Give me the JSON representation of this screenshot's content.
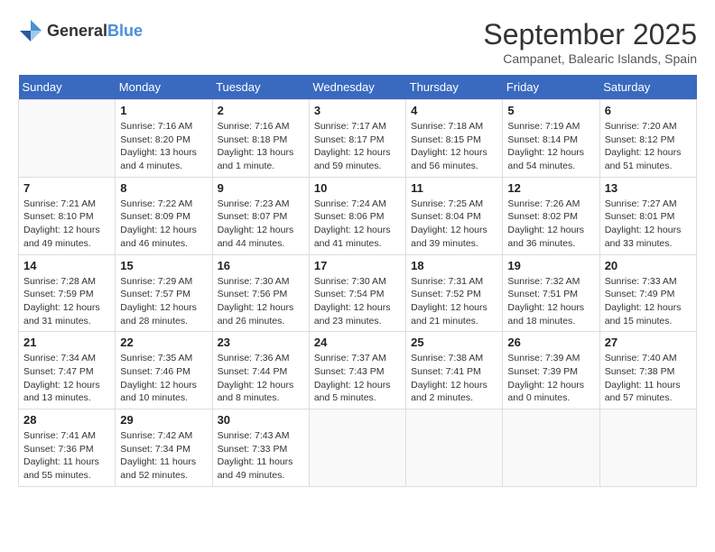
{
  "logo": {
    "general": "General",
    "blue": "Blue"
  },
  "title": "September 2025",
  "location": "Campanet, Balearic Islands, Spain",
  "weekdays": [
    "Sunday",
    "Monday",
    "Tuesday",
    "Wednesday",
    "Thursday",
    "Friday",
    "Saturday"
  ],
  "weeks": [
    [
      {
        "day": "",
        "info": ""
      },
      {
        "day": "1",
        "info": "Sunrise: 7:16 AM\nSunset: 8:20 PM\nDaylight: 13 hours\nand 4 minutes."
      },
      {
        "day": "2",
        "info": "Sunrise: 7:16 AM\nSunset: 8:18 PM\nDaylight: 13 hours\nand 1 minute."
      },
      {
        "day": "3",
        "info": "Sunrise: 7:17 AM\nSunset: 8:17 PM\nDaylight: 12 hours\nand 59 minutes."
      },
      {
        "day": "4",
        "info": "Sunrise: 7:18 AM\nSunset: 8:15 PM\nDaylight: 12 hours\nand 56 minutes."
      },
      {
        "day": "5",
        "info": "Sunrise: 7:19 AM\nSunset: 8:14 PM\nDaylight: 12 hours\nand 54 minutes."
      },
      {
        "day": "6",
        "info": "Sunrise: 7:20 AM\nSunset: 8:12 PM\nDaylight: 12 hours\nand 51 minutes."
      }
    ],
    [
      {
        "day": "7",
        "info": "Sunrise: 7:21 AM\nSunset: 8:10 PM\nDaylight: 12 hours\nand 49 minutes."
      },
      {
        "day": "8",
        "info": "Sunrise: 7:22 AM\nSunset: 8:09 PM\nDaylight: 12 hours\nand 46 minutes."
      },
      {
        "day": "9",
        "info": "Sunrise: 7:23 AM\nSunset: 8:07 PM\nDaylight: 12 hours\nand 44 minutes."
      },
      {
        "day": "10",
        "info": "Sunrise: 7:24 AM\nSunset: 8:06 PM\nDaylight: 12 hours\nand 41 minutes."
      },
      {
        "day": "11",
        "info": "Sunrise: 7:25 AM\nSunset: 8:04 PM\nDaylight: 12 hours\nand 39 minutes."
      },
      {
        "day": "12",
        "info": "Sunrise: 7:26 AM\nSunset: 8:02 PM\nDaylight: 12 hours\nand 36 minutes."
      },
      {
        "day": "13",
        "info": "Sunrise: 7:27 AM\nSunset: 8:01 PM\nDaylight: 12 hours\nand 33 minutes."
      }
    ],
    [
      {
        "day": "14",
        "info": "Sunrise: 7:28 AM\nSunset: 7:59 PM\nDaylight: 12 hours\nand 31 minutes."
      },
      {
        "day": "15",
        "info": "Sunrise: 7:29 AM\nSunset: 7:57 PM\nDaylight: 12 hours\nand 28 minutes."
      },
      {
        "day": "16",
        "info": "Sunrise: 7:30 AM\nSunset: 7:56 PM\nDaylight: 12 hours\nand 26 minutes."
      },
      {
        "day": "17",
        "info": "Sunrise: 7:30 AM\nSunset: 7:54 PM\nDaylight: 12 hours\nand 23 minutes."
      },
      {
        "day": "18",
        "info": "Sunrise: 7:31 AM\nSunset: 7:52 PM\nDaylight: 12 hours\nand 21 minutes."
      },
      {
        "day": "19",
        "info": "Sunrise: 7:32 AM\nSunset: 7:51 PM\nDaylight: 12 hours\nand 18 minutes."
      },
      {
        "day": "20",
        "info": "Sunrise: 7:33 AM\nSunset: 7:49 PM\nDaylight: 12 hours\nand 15 minutes."
      }
    ],
    [
      {
        "day": "21",
        "info": "Sunrise: 7:34 AM\nSunset: 7:47 PM\nDaylight: 12 hours\nand 13 minutes."
      },
      {
        "day": "22",
        "info": "Sunrise: 7:35 AM\nSunset: 7:46 PM\nDaylight: 12 hours\nand 10 minutes."
      },
      {
        "day": "23",
        "info": "Sunrise: 7:36 AM\nSunset: 7:44 PM\nDaylight: 12 hours\nand 8 minutes."
      },
      {
        "day": "24",
        "info": "Sunrise: 7:37 AM\nSunset: 7:43 PM\nDaylight: 12 hours\nand 5 minutes."
      },
      {
        "day": "25",
        "info": "Sunrise: 7:38 AM\nSunset: 7:41 PM\nDaylight: 12 hours\nand 2 minutes."
      },
      {
        "day": "26",
        "info": "Sunrise: 7:39 AM\nSunset: 7:39 PM\nDaylight: 12 hours\nand 0 minutes."
      },
      {
        "day": "27",
        "info": "Sunrise: 7:40 AM\nSunset: 7:38 PM\nDaylight: 11 hours\nand 57 minutes."
      }
    ],
    [
      {
        "day": "28",
        "info": "Sunrise: 7:41 AM\nSunset: 7:36 PM\nDaylight: 11 hours\nand 55 minutes."
      },
      {
        "day": "29",
        "info": "Sunrise: 7:42 AM\nSunset: 7:34 PM\nDaylight: 11 hours\nand 52 minutes."
      },
      {
        "day": "30",
        "info": "Sunrise: 7:43 AM\nSunset: 7:33 PM\nDaylight: 11 hours\nand 49 minutes."
      },
      {
        "day": "",
        "info": ""
      },
      {
        "day": "",
        "info": ""
      },
      {
        "day": "",
        "info": ""
      },
      {
        "day": "",
        "info": ""
      }
    ]
  ]
}
